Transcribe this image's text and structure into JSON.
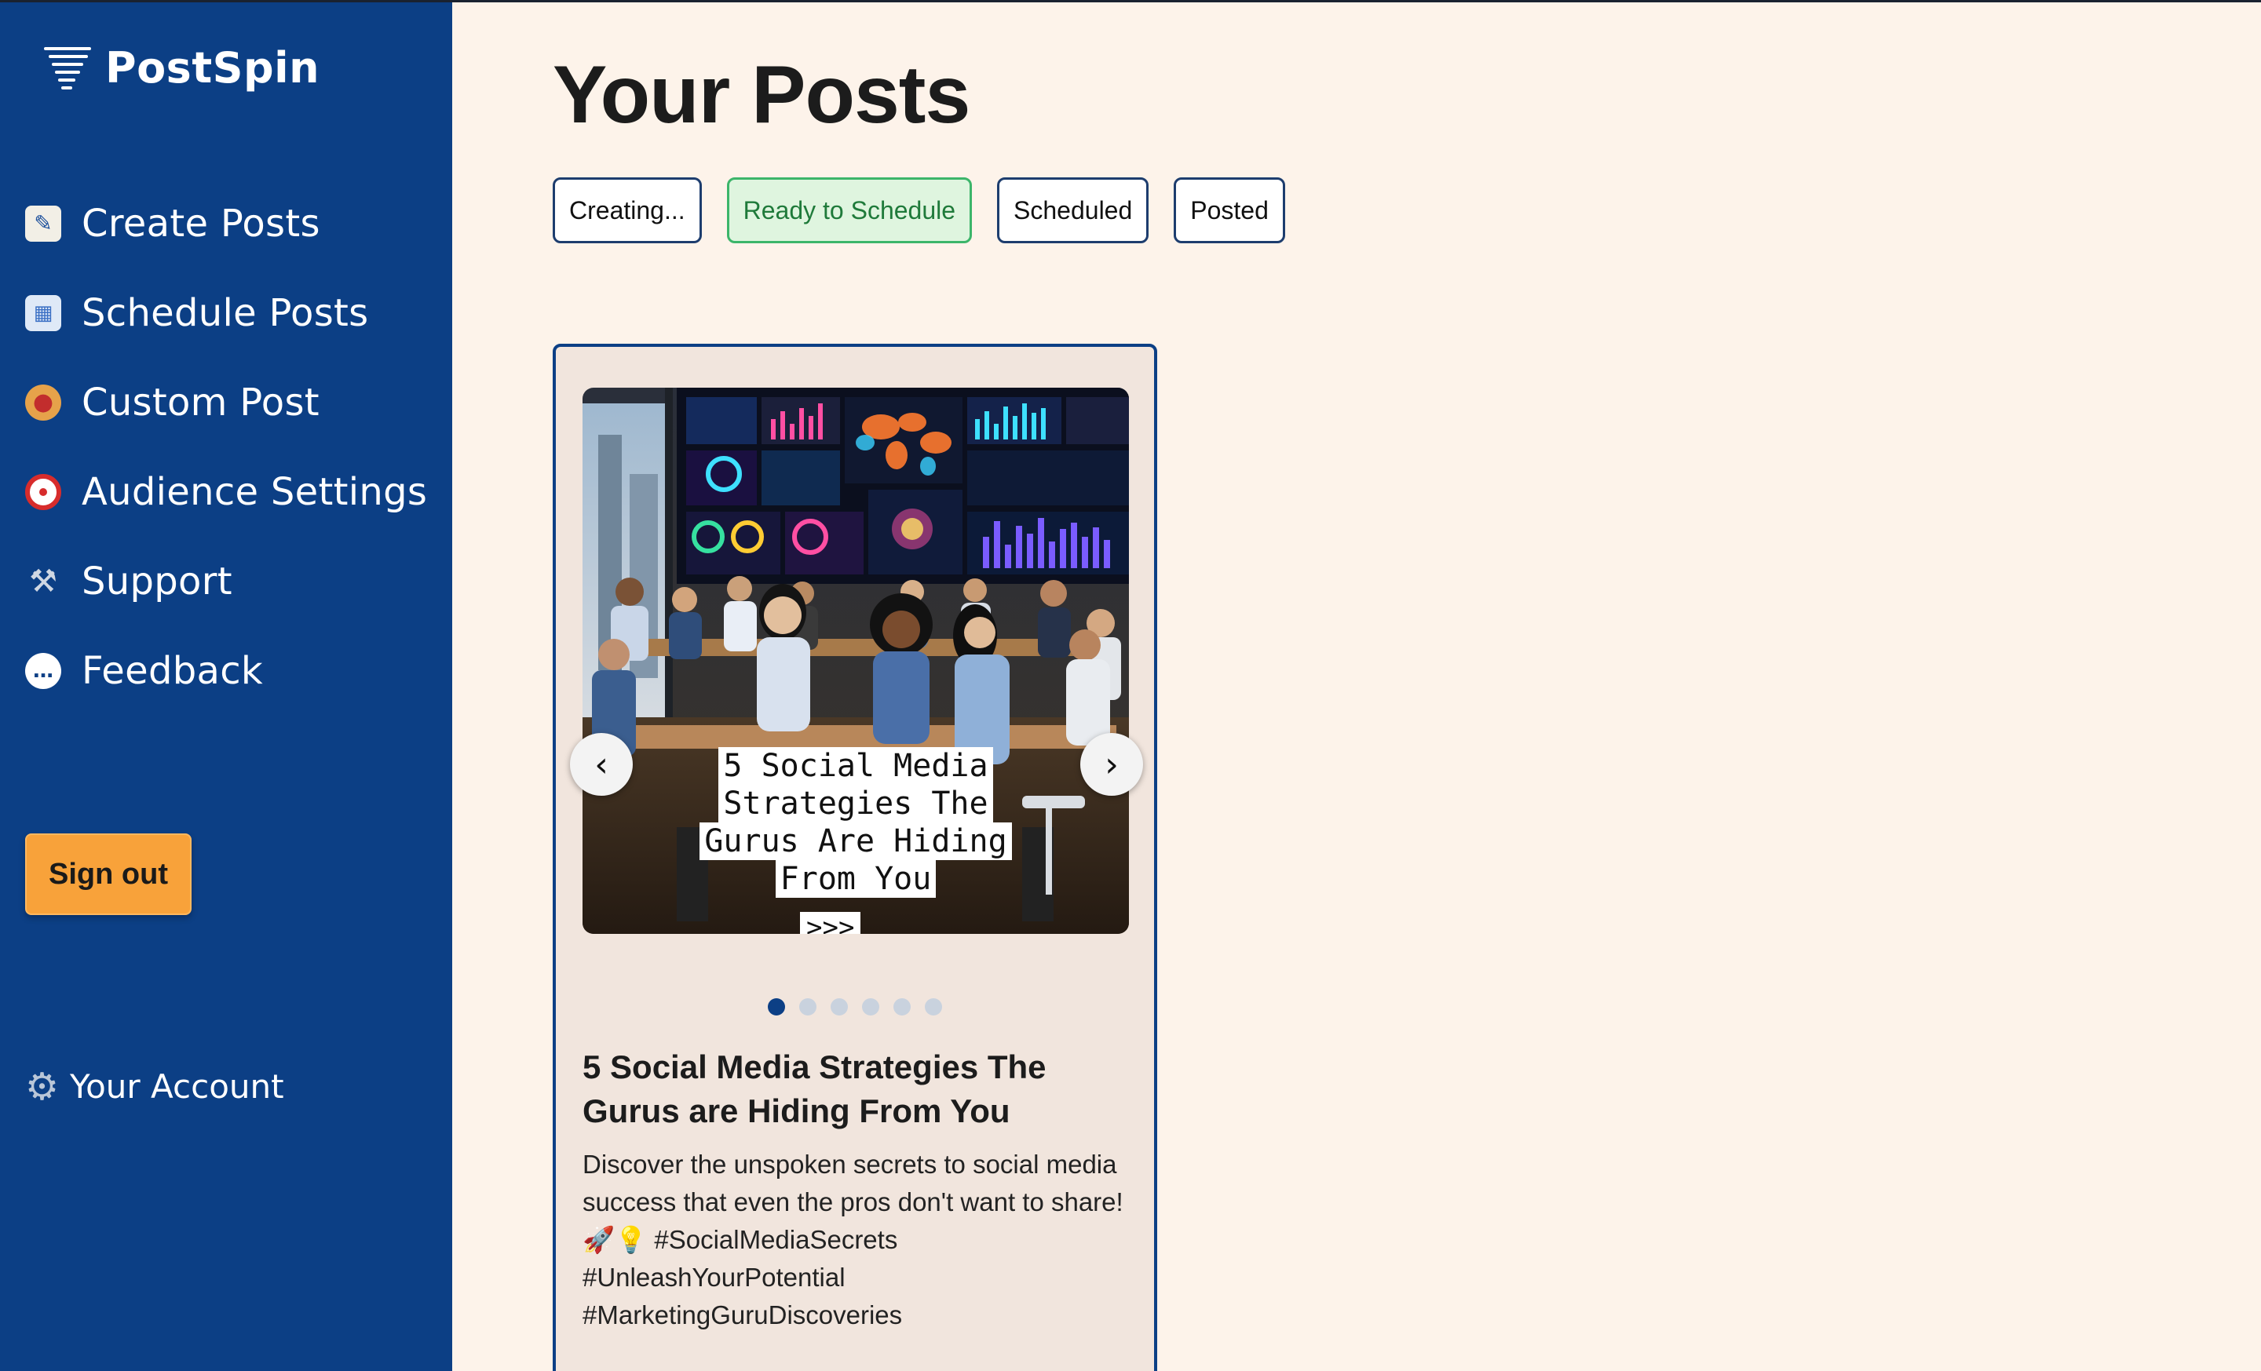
{
  "app": {
    "name": "PostSpin"
  },
  "sidebar": {
    "items": [
      {
        "label": "Create Posts",
        "icon": "memo-icon"
      },
      {
        "label": "Schedule Posts",
        "icon": "calendar-icon"
      },
      {
        "label": "Custom Post",
        "icon": "palette-icon"
      },
      {
        "label": "Audience Settings",
        "icon": "target-icon"
      },
      {
        "label": "Support",
        "icon": "tools-icon"
      },
      {
        "label": "Feedback",
        "icon": "speech-bubble-icon"
      }
    ],
    "sign_out_label": "Sign out",
    "account_label": "Your Account",
    "colors": {
      "background": "#0c3f85",
      "sign_out": "#f8a23a"
    }
  },
  "main": {
    "title": "Your Posts",
    "tabs": [
      {
        "label": "Creating...",
        "active": false
      },
      {
        "label": "Ready to Schedule",
        "active": true
      },
      {
        "label": "Scheduled",
        "active": false
      },
      {
        "label": "Posted",
        "active": false
      }
    ],
    "colors": {
      "background": "#fdf3ea",
      "active_tab": "#3cb56a"
    }
  },
  "post": {
    "image_caption_lines": [
      "5 Social Media",
      "Strategies The",
      "Gurus Are Hiding",
      "From You"
    ],
    "image_more": ">>>",
    "slide_count": 6,
    "active_slide": 1,
    "title": "5 Social Media Strategies The Gurus are Hiding From You",
    "description": "Discover the unspoken secrets to social media success that even the pros don't want to share! 🚀💡 #SocialMediaSecrets #UnleashYourPotential #MarketingGuruDiscoveries"
  }
}
